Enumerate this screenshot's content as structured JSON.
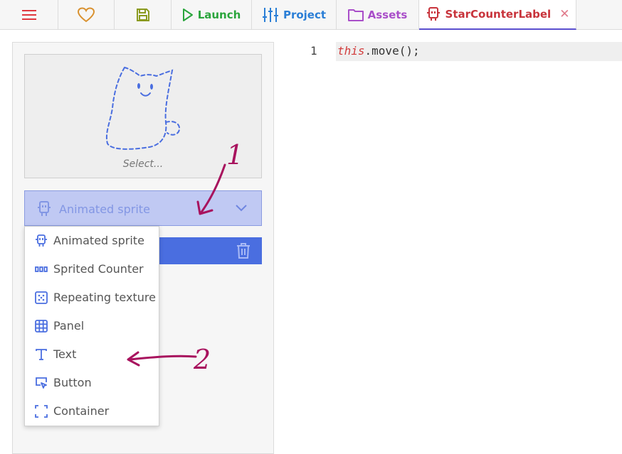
{
  "tabs": [
    {
      "name": "menu",
      "icon": "hamburger-icon",
      "color": "#e0383e"
    },
    {
      "name": "favorite",
      "icon": "heart-icon",
      "color": "#d9912f"
    },
    {
      "name": "save",
      "icon": "save-icon",
      "color": "#8a9a1e"
    },
    {
      "name": "launch",
      "label": "Launch",
      "icon": "play-icon",
      "color": "#2aa53c"
    },
    {
      "name": "project",
      "label": "Project",
      "icon": "sliders-icon",
      "color": "#2a7ed6"
    },
    {
      "name": "assets",
      "label": "Assets",
      "icon": "folder-icon",
      "color": "#a94ec9"
    },
    {
      "name": "star-counter-label",
      "label": "StarCounterLabel",
      "icon": "template-icon",
      "color": "#c8333b",
      "close": "✕"
    }
  ],
  "preview": {
    "label": "Select..."
  },
  "dropdown": {
    "value": "Animated sprite",
    "icon": "animated-sprite-icon"
  },
  "menu": {
    "items": [
      {
        "label": "Animated sprite",
        "icon": "animated-sprite-icon"
      },
      {
        "label": "Sprited Counter",
        "icon": "sprited-counter-icon"
      },
      {
        "label": "Repeating texture",
        "icon": "repeating-texture-icon"
      },
      {
        "label": "Panel",
        "icon": "panel-icon"
      },
      {
        "label": "Text",
        "icon": "text-icon"
      },
      {
        "label": "Button",
        "icon": "button-icon"
      },
      {
        "label": "Container",
        "icon": "container-icon"
      }
    ]
  },
  "editor": {
    "line_number": "1",
    "code_keyword": "this",
    "code_rest": ".move();"
  },
  "annotations": {
    "one": "1",
    "two": "2",
    "color": "#a8135e"
  },
  "colors": {
    "accent_blue": "#4a6ee0",
    "dropdown_bg": "#c0c9f3",
    "icon_blue": "#4a6ee0"
  }
}
